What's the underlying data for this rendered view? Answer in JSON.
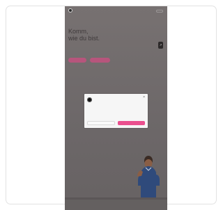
{
  "app": {
    "logo_text": "",
    "menu_label": "",
    "eyebrow": "",
    "headline_line1": "Komm,",
    "headline_line2": "wie du bist.",
    "subtext": "",
    "cta_primary": "",
    "cta_secondary": "",
    "floating_icon": "arrow-icon"
  },
  "modal": {
    "logo_text": "",
    "title": "",
    "body": "",
    "links": [
      "",
      ""
    ],
    "secondary_button": "",
    "primary_button": "",
    "close_icon": "close-icon"
  },
  "colors": {
    "overlay": "#6f6a6b",
    "accent_pink": "#ea4f8e",
    "button_pink": "#b7557c",
    "card_border": "#e2e2e2"
  }
}
